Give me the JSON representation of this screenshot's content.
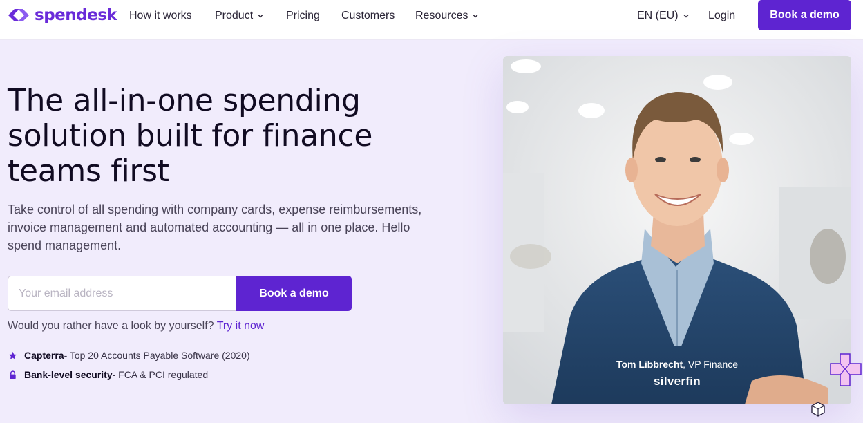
{
  "nav": {
    "brand": "spendesk",
    "items": [
      {
        "label": "How it works",
        "dropdown": false
      },
      {
        "label": "Product",
        "dropdown": true
      },
      {
        "label": "Pricing",
        "dropdown": false
      },
      {
        "label": "Customers",
        "dropdown": false
      },
      {
        "label": "Resources",
        "dropdown": true
      }
    ],
    "language": "EN (EU)",
    "login": "Login",
    "cta": "Book a demo"
  },
  "hero": {
    "headline_lines": [
      "The all-in-one spending",
      "solution built for finance",
      "teams first"
    ],
    "subtitle": "Take control of all spending with company cards, expense reimbursements, invoice management and automated accounting — all in one place. Hello spend management.",
    "email_placeholder": "Your email address",
    "form_cta": "Book a demo",
    "try_prefix": "Would you rather have a look by yourself?",
    "try_link": "Try it now"
  },
  "badges": [
    {
      "icon": "star-icon",
      "title": "Capterra",
      "text": " - Top 20 Accounts Payable Software (2020)"
    },
    {
      "icon": "lock-icon",
      "title": "Bank-level security",
      "text": " - FCA & PCI regulated"
    }
  ],
  "testimonial": {
    "name": "Tom Libbrecht",
    "role": ", VP Finance",
    "company": "silverfin"
  },
  "colors": {
    "brand": "#6a2bd9",
    "cta": "#5e24d1",
    "background": "#f1ecfc"
  }
}
